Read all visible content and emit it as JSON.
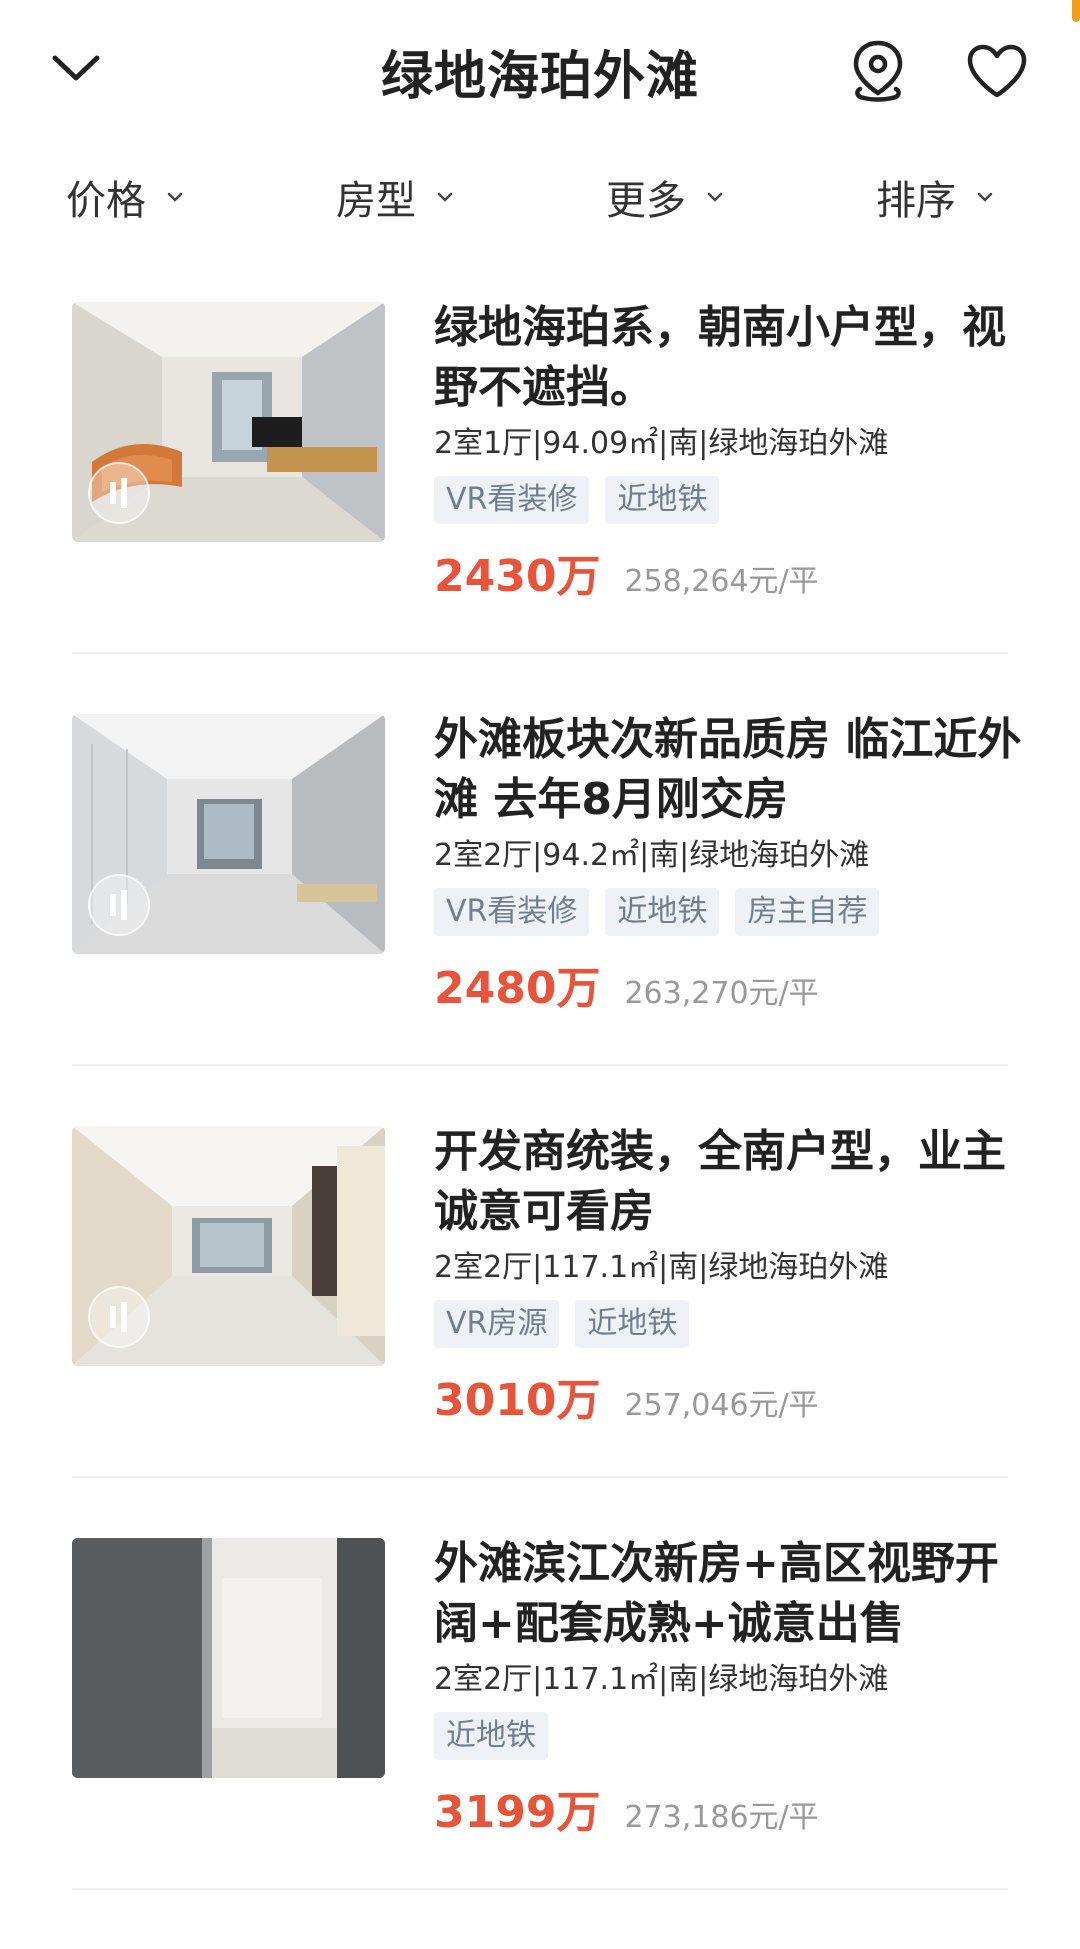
{
  "header": {
    "title": "绿地海珀外滩",
    "back_icon": "chevron-down-icon",
    "map_icon": "map-pin-icon",
    "fav_icon": "heart-icon"
  },
  "filters": [
    {
      "label": "价格"
    },
    {
      "label": "房型"
    },
    {
      "label": "更多"
    },
    {
      "label": "排序"
    }
  ],
  "colors": {
    "accent_price": "#e8543a",
    "tag_bg": "#eef2f6",
    "tag_text": "#6f7f90"
  },
  "listings": [
    {
      "title": "绿地海珀系，朝南小户型，视野不遮挡。",
      "specs": "2室1厅|94.09㎡|南|绿地海珀外滩",
      "tags": [
        "VR看装修",
        "近地铁"
      ],
      "price": "2430万",
      "unit_price": "258,264元/平"
    },
    {
      "title": "外滩板块次新品质房 临江近外滩 去年8月刚交房",
      "specs": "2室2厅|94.2㎡|南|绿地海珀外滩",
      "tags": [
        "VR看装修",
        "近地铁",
        "房主自荐"
      ],
      "price": "2480万",
      "unit_price": "263,270元/平"
    },
    {
      "title": "开发商统装，全南户型，业主诚意可看房",
      "specs": "2室2厅|117.1㎡|南|绿地海珀外滩",
      "tags": [
        "VR房源",
        "近地铁"
      ],
      "price": "3010万",
      "unit_price": "257,046元/平"
    },
    {
      "title": "外滩滨江次新房+高区视野开阔+配套成熟+诚意出售",
      "specs": "2室2厅|117.1㎡|南|绿地海珀外滩",
      "tags": [
        "近地铁"
      ],
      "price": "3199万",
      "unit_price": "273,186元/平"
    }
  ]
}
